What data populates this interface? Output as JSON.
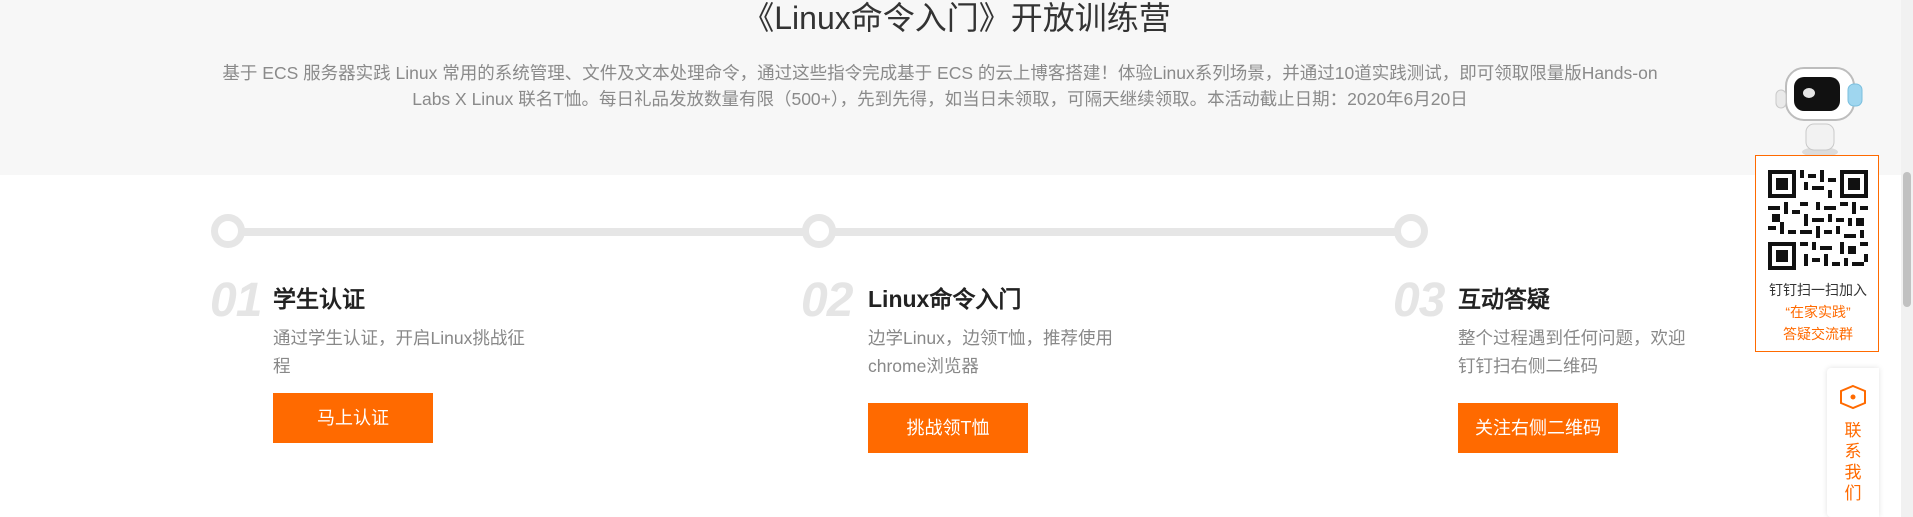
{
  "hero": {
    "title": "《Linux命令入门》开放训练营",
    "description_line1": "基于 ECS 服务器实践 Linux 常用的系统管理、文件及文本处理命令，通过这些指令完成基于 ECS 的云上博客搭建！体验Linux系列场景，并通过10道实践测试，即可领取限量版Hands-on",
    "description_line2": "Labs X Linux 联名T恤。每日礼品发放数量有限（500+），先到先得，如当日未领取，可隔天继续领取。本活动截止日期：2020年6月20日"
  },
  "steps": [
    {
      "number": "01",
      "title": "学生认证",
      "desc_line1": "通过学生认证，开启Linux挑战征",
      "desc_line2": "程",
      "button": "马上认证"
    },
    {
      "number": "02",
      "title": "Linux命令入门",
      "desc_line1": "边学Linux，边领T恤，推荐使用",
      "desc_line2": "chrome浏览器",
      "button": "挑战领T恤"
    },
    {
      "number": "03",
      "title": "互动答疑",
      "desc_line1": "整个过程遇到任何问题，欢迎",
      "desc_line2": "钉钉扫右侧二维码",
      "button": "关注右侧二维码"
    }
  ],
  "qr_panel": {
    "line1": "钉钉扫一扫加入",
    "line2": "“在家实践”",
    "line3": "答疑交流群"
  },
  "contact": {
    "label": "联系我们"
  },
  "colors": {
    "accent": "#ff6a00",
    "track": "#e6e6e6",
    "hero_bg": "#f7f7f7"
  },
  "icons": [
    "robot-mascot-icon",
    "qr-code-icon",
    "chat-bubble-icon"
  ]
}
